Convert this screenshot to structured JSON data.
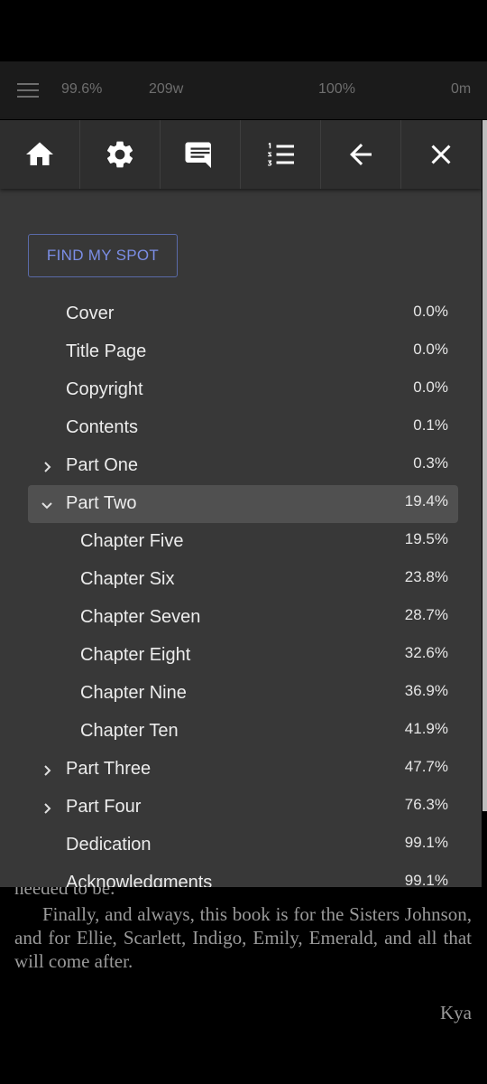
{
  "reader_bar": {
    "progress": "99.6%",
    "words": "209w",
    "zoom": "100%",
    "time": "0m"
  },
  "toolbar": {
    "buttons": [
      {
        "name": "home-button",
        "icon": "home-icon"
      },
      {
        "name": "settings-button",
        "icon": "gear-icon"
      },
      {
        "name": "notes-button",
        "icon": "comment-icon"
      },
      {
        "name": "toc-button",
        "icon": "numbered-list-icon"
      },
      {
        "name": "back-button",
        "icon": "arrow-left-icon"
      },
      {
        "name": "close-button",
        "icon": "close-icon"
      }
    ]
  },
  "find_spot_label": "FIND MY SPOT",
  "toc": [
    {
      "label": "Cover",
      "pct": "0.0%",
      "level": 0,
      "toggle": "none",
      "selected": false
    },
    {
      "label": "Title Page",
      "pct": "0.0%",
      "level": 0,
      "toggle": "none",
      "selected": false
    },
    {
      "label": "Copyright",
      "pct": "0.0%",
      "level": 0,
      "toggle": "none",
      "selected": false
    },
    {
      "label": "Contents",
      "pct": "0.1%",
      "level": 0,
      "toggle": "none",
      "selected": false
    },
    {
      "label": "Part One",
      "pct": "0.3%",
      "level": 0,
      "toggle": "collapsed",
      "selected": false
    },
    {
      "label": "Part Two",
      "pct": "19.4%",
      "level": 0,
      "toggle": "expanded",
      "selected": true
    },
    {
      "label": "Chapter Five",
      "pct": "19.5%",
      "level": 1,
      "toggle": "none",
      "selected": false
    },
    {
      "label": "Chapter Six",
      "pct": "23.8%",
      "level": 1,
      "toggle": "none",
      "selected": false
    },
    {
      "label": "Chapter Seven",
      "pct": "28.7%",
      "level": 1,
      "toggle": "none",
      "selected": false
    },
    {
      "label": "Chapter Eight",
      "pct": "32.6%",
      "level": 1,
      "toggle": "none",
      "selected": false
    },
    {
      "label": "Chapter Nine",
      "pct": "36.9%",
      "level": 1,
      "toggle": "none",
      "selected": false
    },
    {
      "label": "Chapter Ten",
      "pct": "41.9%",
      "level": 1,
      "toggle": "none",
      "selected": false
    },
    {
      "label": "Part Three",
      "pct": "47.7%",
      "level": 0,
      "toggle": "collapsed",
      "selected": false
    },
    {
      "label": "Part Four",
      "pct": "76.3%",
      "level": 0,
      "toggle": "collapsed",
      "selected": false
    },
    {
      "label": "Dedication",
      "pct": "99.1%",
      "level": 0,
      "toggle": "none",
      "selected": false
    },
    {
      "label": "Acknowledgments",
      "pct": "99.1%",
      "level": 0,
      "toggle": "none",
      "selected": false
    }
  ],
  "book_text": {
    "cut_line": "needed to be.",
    "paragraph": "Finally, and always, this book is for the Sisters Johnson, and for Ellie, Scarlett, Indigo, Emily, Emerald, and all that will come after.",
    "signature": "Kya"
  }
}
